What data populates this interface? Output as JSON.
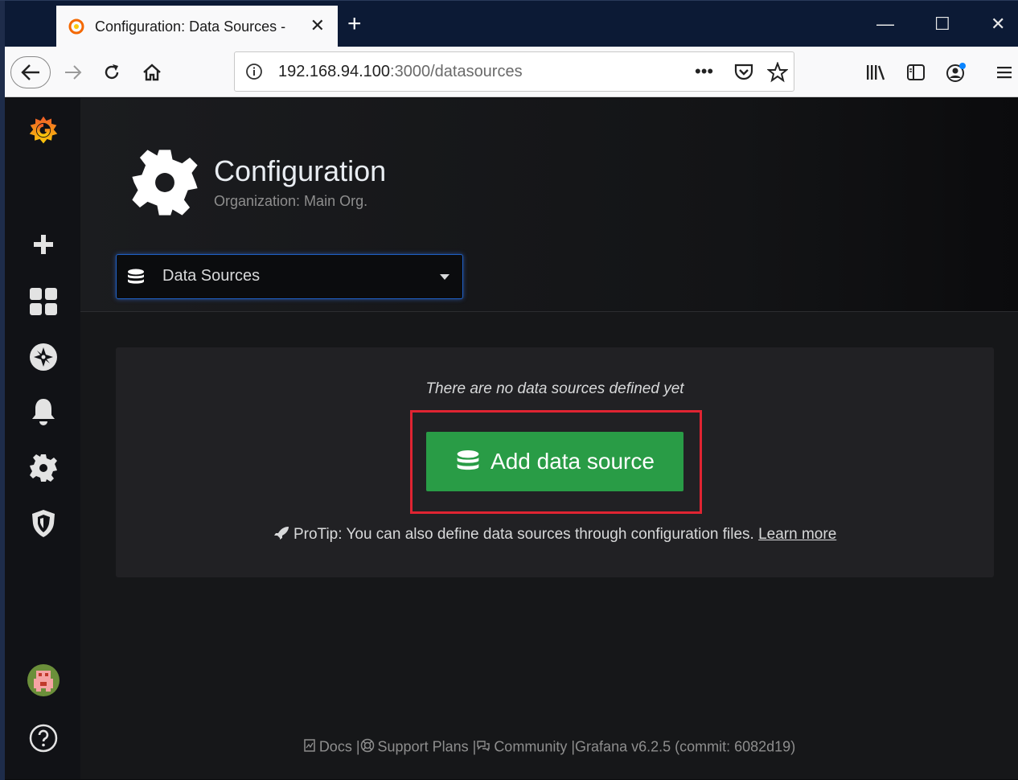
{
  "browser": {
    "tab_title": "Configuration: Data Sources -",
    "tab_close": "✕",
    "new_tab": "+",
    "window_controls": {
      "minimize": "—",
      "maximize": "☐",
      "close": "✕"
    },
    "url_host": "192.168.94.100",
    "url_path": ":3000/datasources",
    "page_actions": "•••",
    "icons": [
      "back-icon",
      "forward-icon",
      "reload-icon",
      "home-icon",
      "info-icon",
      "pocket-icon",
      "bookmark-star-icon",
      "library-icon",
      "sidebar-icon",
      "account-icon",
      "menu-icon"
    ]
  },
  "sidebar": {
    "icons": [
      "grafana-logo-icon",
      "create-plus-icon",
      "dashboards-icon",
      "explore-compass-icon",
      "alerting-bell-icon",
      "configuration-gear-icon",
      "server-admin-shield-icon",
      "user-avatar-icon",
      "help-icon"
    ]
  },
  "header": {
    "title": "Configuration",
    "subtitle": "Organization: Main Org."
  },
  "nav_select": {
    "selected": "Data Sources"
  },
  "empty_state": {
    "message": "There are no data sources defined yet",
    "button_label": "Add data source",
    "protip_text": "ProTip: You can also define data sources through configuration files.",
    "protip_link": "Learn more"
  },
  "footer": {
    "docs": "Docs",
    "support": "Support Plans",
    "community": "Community",
    "version": "Grafana v6.2.5 (commit: 6082d19)",
    "separator": "|"
  },
  "colors": {
    "primary_button": "#299c46",
    "highlight_border": "#e02432",
    "select_focus": "#1f60c4",
    "grafana_orange": "#f46800"
  }
}
